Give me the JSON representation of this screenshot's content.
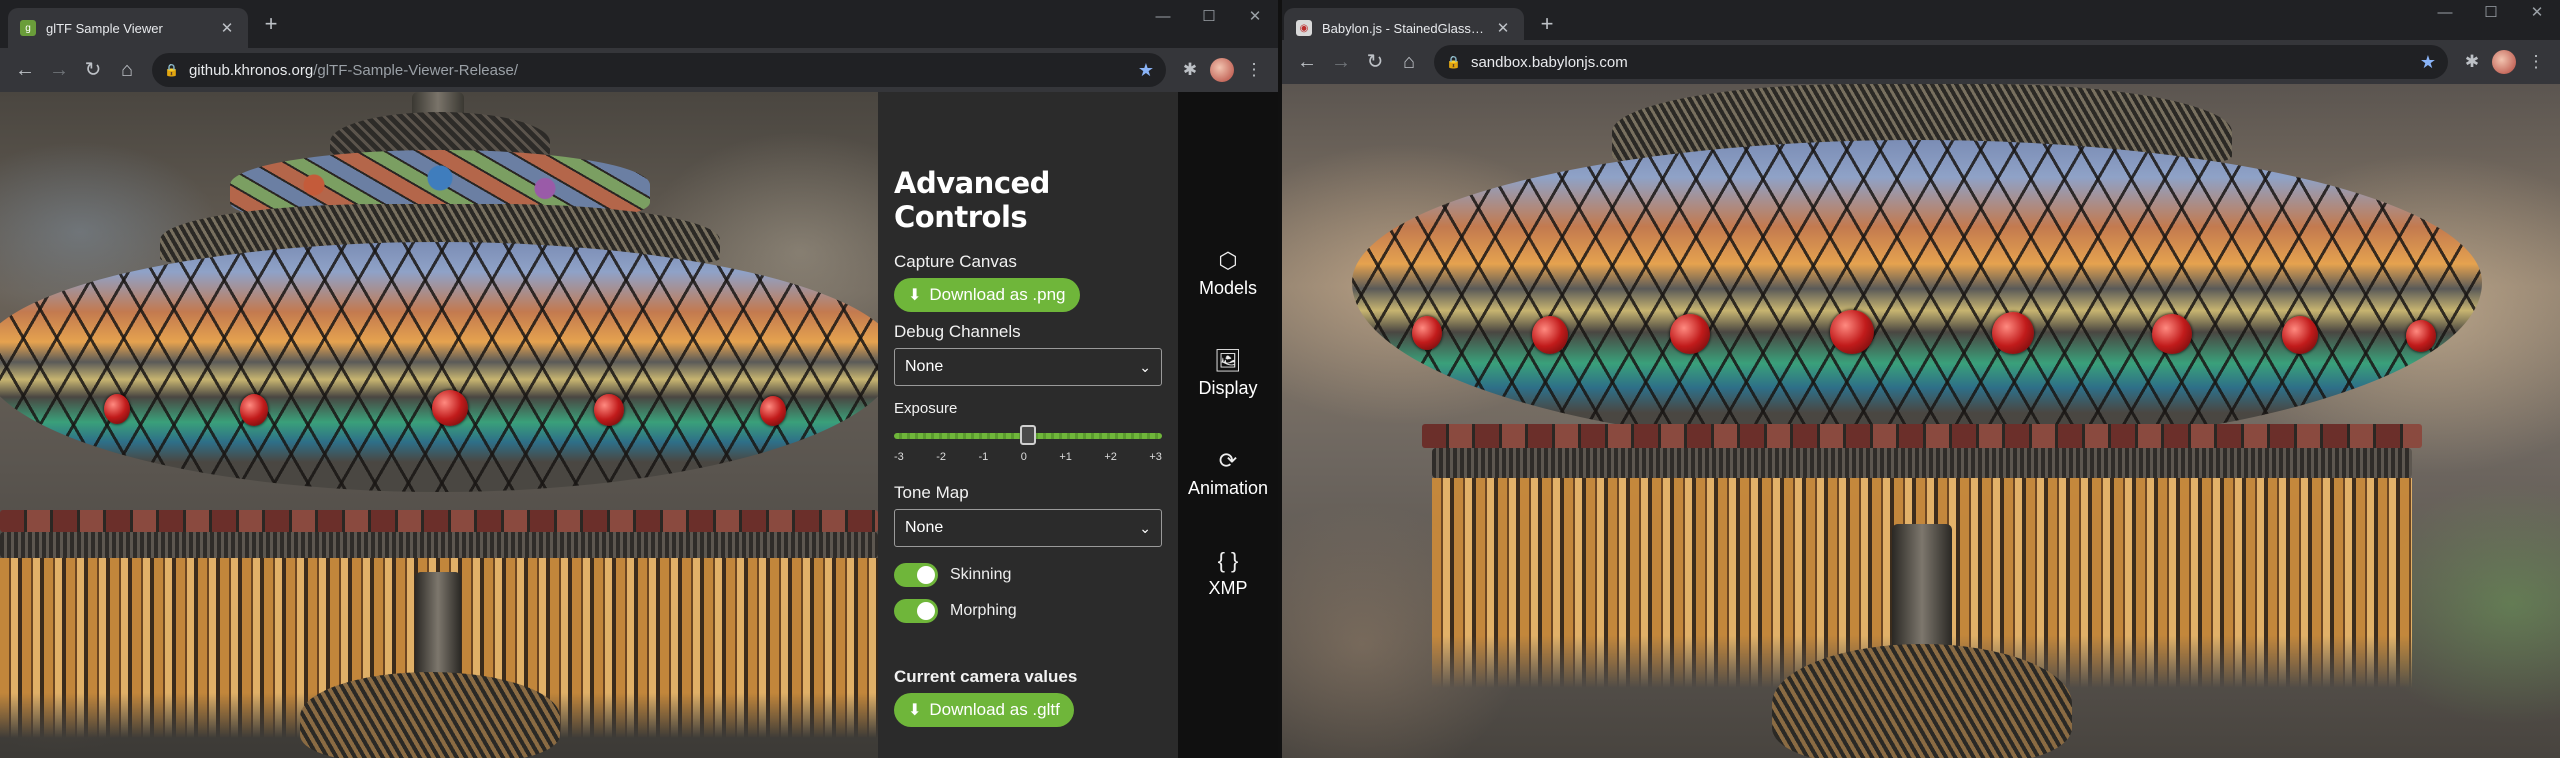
{
  "left_window": {
    "tab_title": "glTF Sample Viewer",
    "url_host": "github.khronos.org",
    "url_path": "/glTF-Sample-Viewer-Release/",
    "panel": {
      "heading": "Advanced Controls",
      "capture_label": "Capture Canvas",
      "download_png": "Download as .png",
      "debug_label": "Debug Channels",
      "debug_value": "None",
      "exposure_label": "Exposure",
      "exposure_value": 0,
      "exposure_ticks": [
        "-3",
        "-2",
        "-1",
        "0",
        "+1",
        "+2",
        "+3"
      ],
      "tonemap_label": "Tone Map",
      "tonemap_value": "None",
      "skinning_label": "Skinning",
      "skinning_on": true,
      "morphing_label": "Morphing",
      "morphing_on": true,
      "camera_label": "Current camera values",
      "download_gltf": "Download as .gltf"
    },
    "sidebar": [
      {
        "label": "Models",
        "icon": "cube-icon"
      },
      {
        "label": "Display",
        "icon": "image-icon"
      },
      {
        "label": "Animation",
        "icon": "animation-icon"
      },
      {
        "label": "XMP",
        "icon": "braces-icon"
      }
    ]
  },
  "right_window": {
    "tab_title": "Babylon.js - StainedGlassLamp-Ji",
    "url_host": "sandbox.babylonjs.com"
  },
  "colors": {
    "accent_green": "#6fb63a",
    "panel_bg": "#2b2b2b",
    "sidebar_bg": "#101010",
    "bookmark_star": "#8ab4f8"
  }
}
